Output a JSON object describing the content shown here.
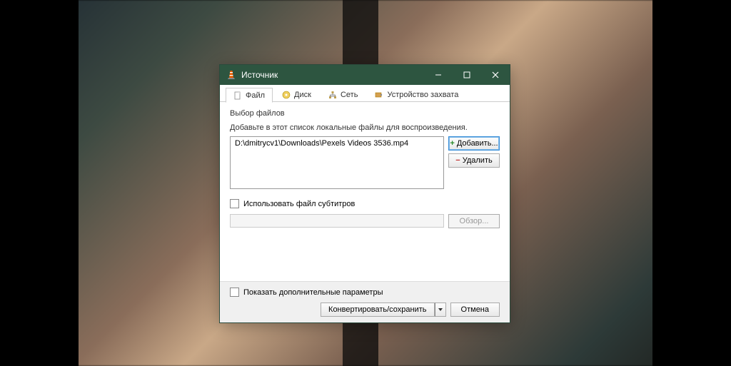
{
  "window": {
    "title": "Источник"
  },
  "tabs": {
    "file": "Файл",
    "disc": "Диск",
    "network": "Сеть",
    "capture": "Устройство захвата"
  },
  "fileSection": {
    "heading": "Выбор файлов",
    "description": "Добавьте в этот список локальные файлы для воспроизведения.",
    "files": [
      "D:\\dmitrycv1\\Downloads\\Pexels Videos 3536.mp4"
    ],
    "addButton": "Добавить...",
    "removeButton": "Удалить"
  },
  "subtitles": {
    "checkboxLabel": "Использовать файл субтитров",
    "browseButton": "Обзор..."
  },
  "footer": {
    "advancedCheckbox": "Показать дополнительные параметры",
    "convertButton": "Конвертировать/сохранить",
    "cancelButton": "Отмена"
  }
}
